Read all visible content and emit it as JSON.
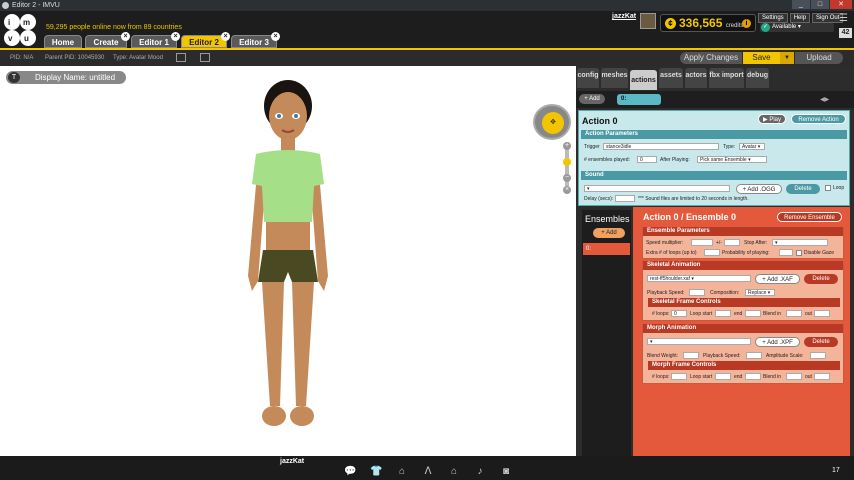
{
  "window": {
    "title": "Editor 2 - IMVU",
    "minimize": "_",
    "maximize": "□",
    "close": "✕"
  },
  "header": {
    "online_text": "59,295 people online now from 89 countries",
    "username": "jazzKat",
    "credits_value": "336,565",
    "credits_label": "credits",
    "links": [
      "Settings",
      "Help",
      "Sign Out"
    ],
    "status": "Available",
    "badge": "42",
    "tabs": [
      {
        "label": "Home"
      },
      {
        "label": "Create"
      },
      {
        "label": "Editor 1"
      },
      {
        "label": "Editor 2"
      },
      {
        "label": "Editor 3"
      }
    ]
  },
  "infobar": {
    "pid": "PID: N/A",
    "parent_pid": "Parent PID: 10045930",
    "type": "Type: Avatar Mood"
  },
  "toolbar": {
    "apply": "Apply Changes",
    "save": "Save",
    "save_arrow": "▼",
    "upload": "Upload"
  },
  "viewport": {
    "display_name": "Display Name: untitled",
    "display_icon": "T"
  },
  "panel": {
    "tabs": [
      "config",
      "meshes",
      "actions",
      "assets",
      "actors",
      "fbx import",
      "debug"
    ],
    "add_action": "+ Add",
    "action_tab": "0:",
    "action_title": "Action 0",
    "play": "Play",
    "remove_action": "Remove Action",
    "action_params": {
      "header": "Action Parameters",
      "trigger_label": "Trigger",
      "trigger_value": "stance3idle",
      "type_label": "Type:",
      "type_value": "Avatar",
      "ensembles_label": "# ensembles played:",
      "ensembles_value": "0",
      "after_label": "After Playing:",
      "after_value": "Pick same Ensemble"
    },
    "sound": {
      "header": "Sound",
      "add_ogg": "+ Add .OGG",
      "delete": "Delete",
      "loop": "Loop",
      "delay_label": "Delay (secs):",
      "note": "*** Sound files are limited to 20 seconds in length."
    },
    "ensembles": {
      "title": "Ensembles",
      "add": "+ Add",
      "item": "0:",
      "heading": "Action 0 / Ensemble 0",
      "remove": "Remove Ensemble",
      "params_header": "Ensemble Parameters",
      "speed_label": "Speed multiplier:",
      "plusminus": "+/-",
      "stop_label": "Stop After:",
      "extra_loops": "Extra # of loops (up to)",
      "probability": "Probability of playing:",
      "disable_gaze": "Disable Gaze",
      "skeletal_header": "Skeletal Animation",
      "skeletal_file": "rest-ff5houlder.xaf",
      "add_xaf": "+ Add .XAF",
      "delete": "Delete",
      "playback_speed": "Playback Speed:",
      "composition": "Composition:",
      "composition_value": "Replace",
      "skel_frame_header": "Skeletal Frame Controls",
      "loops_label": "# loops:",
      "loops_value": "0",
      "loop_start": "Loop start",
      "end_label": "end",
      "blend_in": "Blend in",
      "out_label": "out",
      "morph_header": "Morph Animation",
      "add_xpf": "+ Add .XPF",
      "blend_weight": "Blend Weight:",
      "amplitude": "Amplitude Scale:",
      "morph_frame_header": "Morph Frame Controls"
    }
  },
  "bottombar": {
    "name": "jazzKat",
    "count": "17"
  }
}
